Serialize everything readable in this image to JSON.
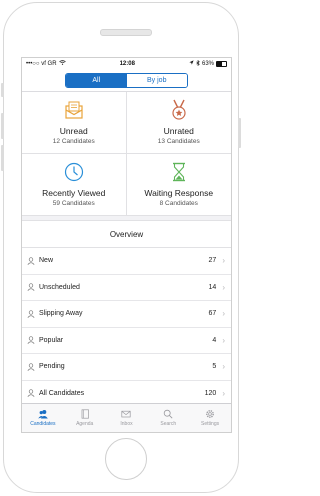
{
  "status_bar": {
    "carrier": "•••○○ vf GR",
    "time": "12:08",
    "battery": "63%"
  },
  "segments": [
    {
      "label": "All",
      "active": true
    },
    {
      "label": "By job",
      "active": false
    }
  ],
  "tiles": [
    {
      "title": "Unread",
      "subtitle": "12 Candidates",
      "icon": "envelope-icon",
      "color": "#e8a33a"
    },
    {
      "title": "Unrated",
      "subtitle": "13 Candidates",
      "icon": "medal-icon",
      "color": "#c96a4a"
    },
    {
      "title": "Recently Viewed",
      "subtitle": "59 Candidates",
      "icon": "clock-icon",
      "color": "#2a8fd8"
    },
    {
      "title": "Waiting Response",
      "subtitle": "8 Candidates",
      "icon": "hourglass-icon",
      "color": "#5fb55a"
    }
  ],
  "overview": {
    "title": "Overview",
    "rows": [
      {
        "label": "New",
        "count": "27"
      },
      {
        "label": "Unscheduled",
        "count": "14"
      },
      {
        "label": "Slipping Away",
        "count": "67"
      },
      {
        "label": "Popular",
        "count": "4"
      },
      {
        "label": "Pending",
        "count": "5"
      },
      {
        "label": "All Candidates",
        "count": "120"
      }
    ]
  },
  "tabbar": [
    {
      "label": "Candidates",
      "icon": "people-icon",
      "active": true
    },
    {
      "label": "Agenda",
      "icon": "agenda-icon",
      "active": false
    },
    {
      "label": "Inbox",
      "icon": "mail-icon",
      "active": false
    },
    {
      "label": "Search",
      "icon": "search-icon",
      "active": false
    },
    {
      "label": "Settings",
      "icon": "gear-icon",
      "active": false
    }
  ],
  "colors": {
    "accent": "#1a6fc4"
  }
}
